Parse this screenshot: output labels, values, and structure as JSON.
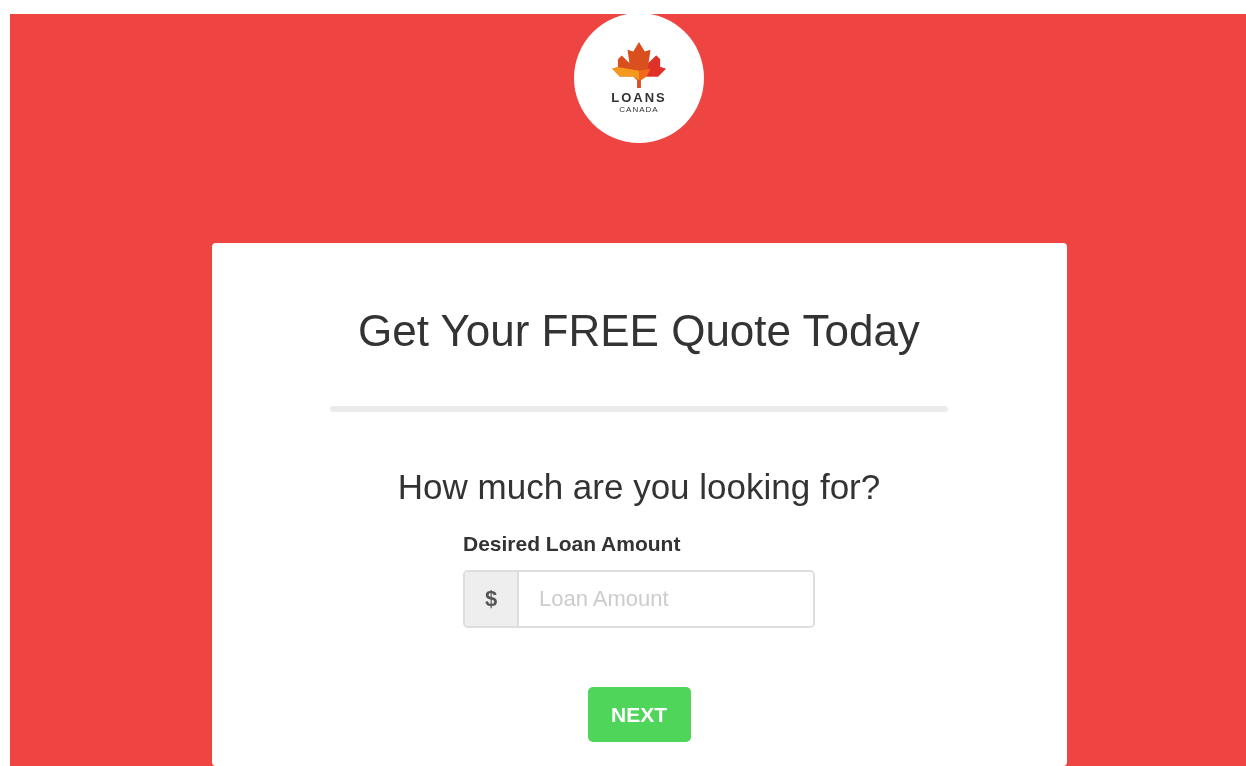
{
  "logo": {
    "name": "LOANS",
    "subtitle": "CANADA"
  },
  "card": {
    "title": "Get Your FREE Quote Today",
    "question": "How much are you looking for?",
    "field": {
      "label": "Desired Loan Amount",
      "prefix": "$",
      "placeholder": "Loan Amount"
    },
    "button": "NEXT"
  }
}
